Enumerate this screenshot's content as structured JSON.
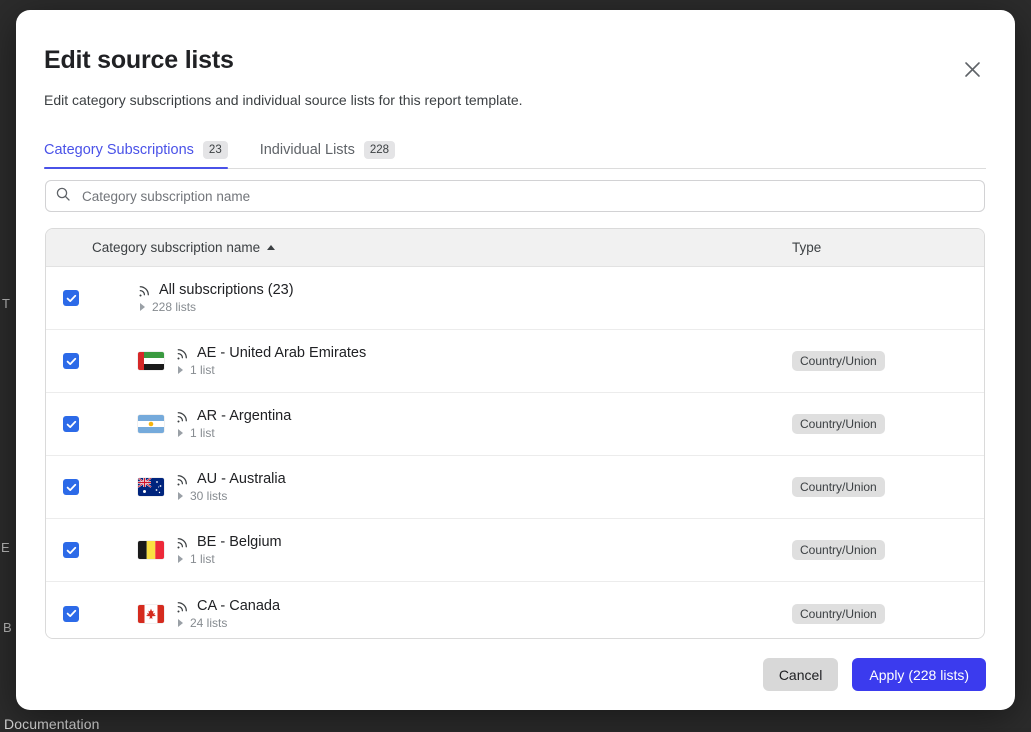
{
  "background": {
    "fragments": [
      "T",
      "E",
      "B",
      "Documentation"
    ]
  },
  "modal": {
    "title": "Edit source lists",
    "subtitle": "Edit category subscriptions and individual source lists for this report template.",
    "close_icon": "close-icon"
  },
  "tabs": [
    {
      "label": "Category Subscriptions",
      "count": "23",
      "active": true
    },
    {
      "label": "Individual Lists",
      "count": "228",
      "active": false
    }
  ],
  "search": {
    "icon": "search-icon",
    "value": "",
    "placeholder": "Category subscription name"
  },
  "table": {
    "columns": [
      {
        "key": "name",
        "label": "Category subscription name",
        "sorted": "asc"
      },
      {
        "key": "type",
        "label": "Type"
      }
    ],
    "rows": [
      {
        "checked": true,
        "flag": null,
        "name": "All subscriptions (23)",
        "sub": "228 lists",
        "type": ""
      },
      {
        "checked": true,
        "flag": "ae",
        "name": "AE - United Arab Emirates",
        "sub": "1 list",
        "type": "Country/Union"
      },
      {
        "checked": true,
        "flag": "ar",
        "name": "AR - Argentina",
        "sub": "1 list",
        "type": "Country/Union"
      },
      {
        "checked": true,
        "flag": "au",
        "name": "AU - Australia",
        "sub": "30 lists",
        "type": "Country/Union"
      },
      {
        "checked": true,
        "flag": "be",
        "name": "BE - Belgium",
        "sub": "1 list",
        "type": "Country/Union"
      },
      {
        "checked": true,
        "flag": "ca",
        "name": "CA - Canada",
        "sub": "24 lists",
        "type": "Country/Union"
      }
    ]
  },
  "footer": {
    "cancel_label": "Cancel",
    "apply_label": "Apply (228 lists)"
  },
  "colors": {
    "accent": "#4a52e8",
    "apply_button": "#3b3bee",
    "checkbox": "#2c6ae8",
    "badge_bg": "#dfdfdf",
    "backdrop": "#2c2c2c"
  }
}
